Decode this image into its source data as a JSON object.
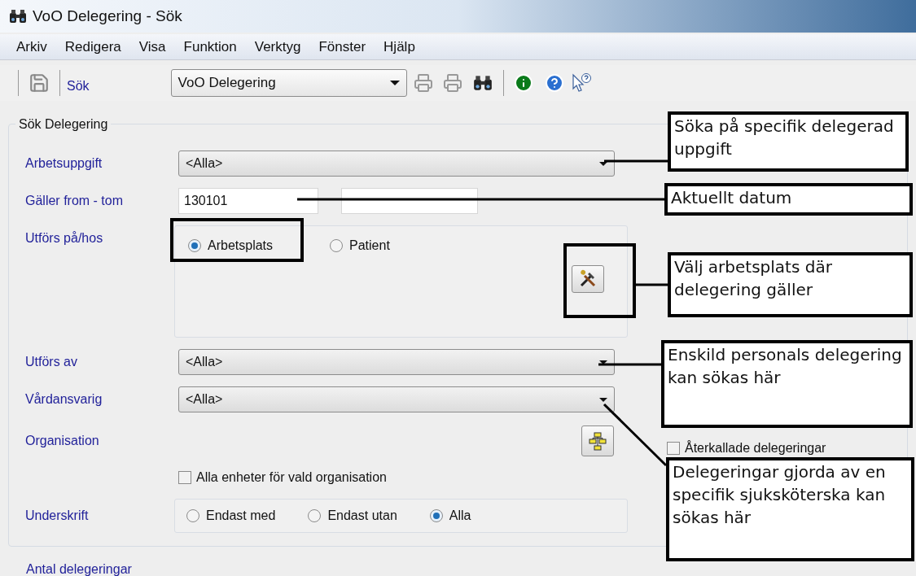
{
  "window": {
    "title": "VoO Delegering - Sök"
  },
  "menu": [
    "Arkiv",
    "Redigera",
    "Visa",
    "Funktion",
    "Verktyg",
    "Fönster",
    "Hjälp"
  ],
  "toolbar": {
    "label": "Sök",
    "module": "VoO Delegering"
  },
  "group": {
    "title": "Sök Delegering"
  },
  "fields": [
    {
      "kind": "dropdown",
      "label": "Arbetsuppgift",
      "value": "<Alla>"
    },
    {
      "kind": "daterange",
      "label": "Gäller from - tom",
      "from": "130101"
    },
    {
      "kind": "place",
      "label": "Utförs på/hos",
      "options": [
        {
          "label": "Arbetsplats",
          "selected": true
        },
        {
          "label": "Patient",
          "selected": false
        }
      ]
    },
    {
      "kind": "dropdown",
      "label": "Utförs av",
      "value": "<Alla>"
    },
    {
      "kind": "dropdown",
      "label": "Vårdansvarig",
      "value": "<Alla>"
    },
    {
      "kind": "org",
      "label": "Organisation",
      "checkbox": {
        "label": "Alla enheter för vald organisation",
        "checked": false
      },
      "side_checkbox": {
        "label": "Återkallade delegeringar",
        "checked": false
      }
    },
    {
      "kind": "radios",
      "label": "Underskrift",
      "options": [
        {
          "label": "Endast med",
          "selected": false
        },
        {
          "label": "Endast utan",
          "selected": false
        },
        {
          "label": "Alla",
          "selected": true
        }
      ]
    }
  ],
  "footer_label": "Antal delegeringar",
  "callouts": [
    {
      "text": "Söka på specifik delegerad uppgift"
    },
    {
      "text": "Aktuellt datum"
    },
    {
      "text": "Välj arbetsplats där delegering gäller"
    },
    {
      "text": "Enskild personals delegering kan sökas här"
    },
    {
      "text": "Delegeringar gjorda av en specifik sjuksköterska kan sökas här"
    }
  ]
}
